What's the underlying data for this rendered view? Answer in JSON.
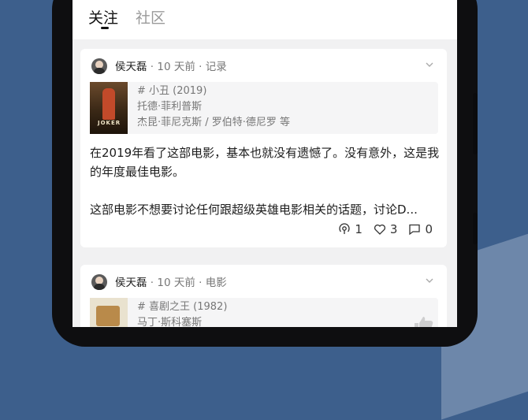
{
  "tabs": [
    {
      "label": "关注",
      "active": true
    },
    {
      "label": "社区",
      "active": false
    }
  ],
  "feed": [
    {
      "user": "侯天磊",
      "meta": " · 10 天前 · 记录",
      "movie": {
        "title": "# 小丑 (2019)",
        "director": "托德·菲利普斯",
        "cast": "杰昆·菲尼克斯 / 罗伯特·德尼罗 等"
      },
      "review_p1": "在2019年看了这部电影，基本也就没有遗憾了。没有意外，这是我的年度最佳电影。",
      "review_p2": "这部电影不想要讨论任何跟超级英雄电影相关的话题，讨论D...",
      "counts": {
        "views": "1",
        "likes": "3",
        "comments": "0"
      }
    },
    {
      "user": "侯天磊",
      "meta": " · 10 天前 · 电影",
      "movie": {
        "title": "# 喜剧之王 (1982)",
        "director": "马丁·斯科塞斯"
      }
    }
  ],
  "colors": {
    "background": "#3d5f8c",
    "screen": "#f1f1f2",
    "card": "#ffffff"
  }
}
